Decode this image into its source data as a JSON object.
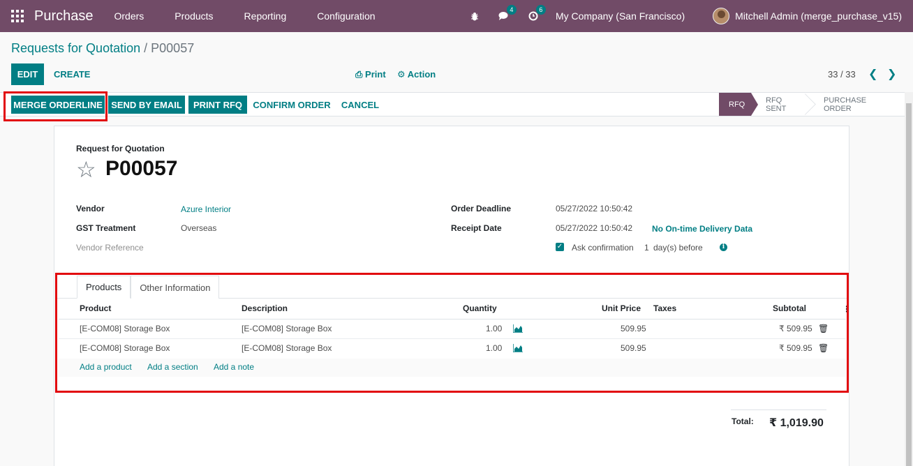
{
  "navbar": {
    "app_name": "Purchase",
    "menu": [
      "Orders",
      "Products",
      "Reporting",
      "Configuration"
    ],
    "chat_count": "4",
    "activity_count": "6",
    "company": "My Company (San Francisco)",
    "user": "Mitchell Admin (merge_purchase_v15)"
  },
  "breadcrumb": {
    "parent": "Requests for Quotation",
    "separator": "/",
    "current": "P00057"
  },
  "control": {
    "edit": "EDIT",
    "create": "CREATE",
    "print": "Print",
    "action": "Action",
    "pager": "33 / 33"
  },
  "statusbar": {
    "buttons": [
      "MERGE ORDERLINE",
      "SEND BY EMAIL",
      "PRINT RFQ",
      "CONFIRM ORDER",
      "CANCEL"
    ],
    "stages": [
      "RFQ",
      "RFQ SENT",
      "PURCHASE ORDER"
    ]
  },
  "form": {
    "label": "Request for Quotation",
    "name": "P00057",
    "vendor_label": "Vendor",
    "vendor": "Azure Interior",
    "gst_label": "GST Treatment",
    "gst": "Overseas",
    "vendor_ref_label": "Vendor Reference",
    "deadline_label": "Order Deadline",
    "deadline": "05/27/2022 10:50:42",
    "receipt_label": "Receipt Date",
    "receipt": "05/27/2022 10:50:42",
    "on_time": "No On-time Delivery Data",
    "ask_confirmation": "Ask confirmation",
    "days": "1",
    "days_suffix": "day(s) before"
  },
  "notebook": {
    "tabs": [
      "Products",
      "Other Information"
    ],
    "columns": [
      "Product",
      "Description",
      "Quantity",
      "Unit Price",
      "Taxes",
      "Subtotal"
    ],
    "rows": [
      {
        "product": "[E-COM08] Storage Box",
        "description": "[E-COM08] Storage Box",
        "quantity": "1.00",
        "unit_price": "509.95",
        "subtotal": "₹ 509.95"
      },
      {
        "product": "[E-COM08] Storage Box",
        "description": "[E-COM08] Storage Box",
        "quantity": "1.00",
        "unit_price": "509.95",
        "subtotal": "₹ 509.95"
      }
    ],
    "add_product": "Add a product",
    "add_section": "Add a section",
    "add_note": "Add a note"
  },
  "totals": {
    "label": "Total:",
    "value": "₹ 1,019.90"
  }
}
